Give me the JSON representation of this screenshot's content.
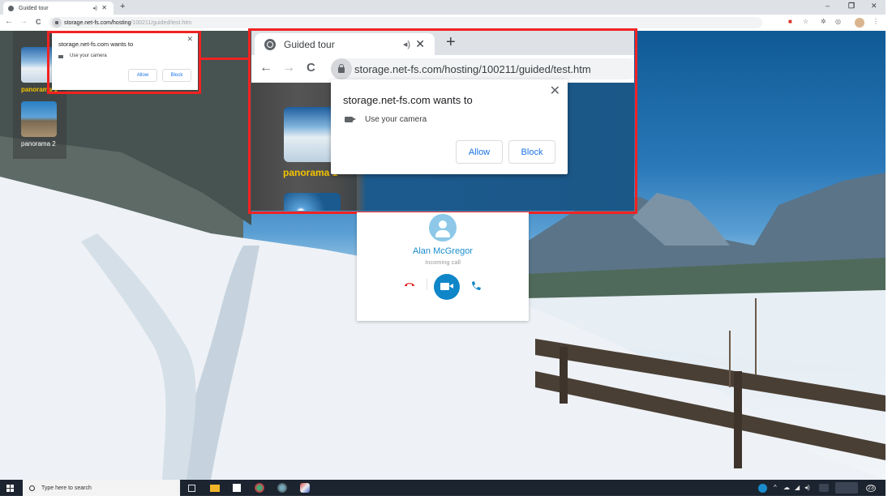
{
  "browser": {
    "tab_title": "Guided tour",
    "new_tab_symbol": "+",
    "url_host": "storage.net-fs.com/hosting",
    "url_path": "/100211/guided/test.htm",
    "url_full": "storage.net-fs.com/hosting/100211/guided/test.htm",
    "window_controls": {
      "minimize": "–",
      "maximize": "❐",
      "close": "✕"
    },
    "nav": {
      "back": "←",
      "forward": "→",
      "reload": "C"
    },
    "toolbar_icons": [
      "blocked-camera-icon",
      "bookmark-star-icon",
      "extensions-icon",
      "media-icon",
      "profile-avatar",
      "menu-icon"
    ]
  },
  "permission_prompt": {
    "title": "storage.net-fs.com wants to",
    "permission": "Use your camera",
    "allow_label": "Allow",
    "block_label": "Block",
    "close_symbol": "✕"
  },
  "inset": {
    "tab_title": "Guided tour",
    "url_full": "storage.net-fs.com/hosting/100211/guided/test.htm",
    "thumb_label_1": "panorama 1"
  },
  "sidebar": {
    "items": [
      {
        "label": "panorama 1",
        "active": true
      },
      {
        "label": "panorama 2",
        "active": false
      }
    ]
  },
  "call": {
    "caller_name": "Alan McGregor",
    "status": "Incoming call",
    "actions": [
      "decline-call",
      "accept-video",
      "accept-voice"
    ]
  },
  "taskbar": {
    "search_placeholder": "Type here to search",
    "notification_count": "23"
  },
  "colors": {
    "highlight": "#f22222",
    "link_blue": "#1a73e8",
    "call_blue": "#0f86c8",
    "decline_red": "#e02020",
    "active_label": "#f5c400"
  }
}
